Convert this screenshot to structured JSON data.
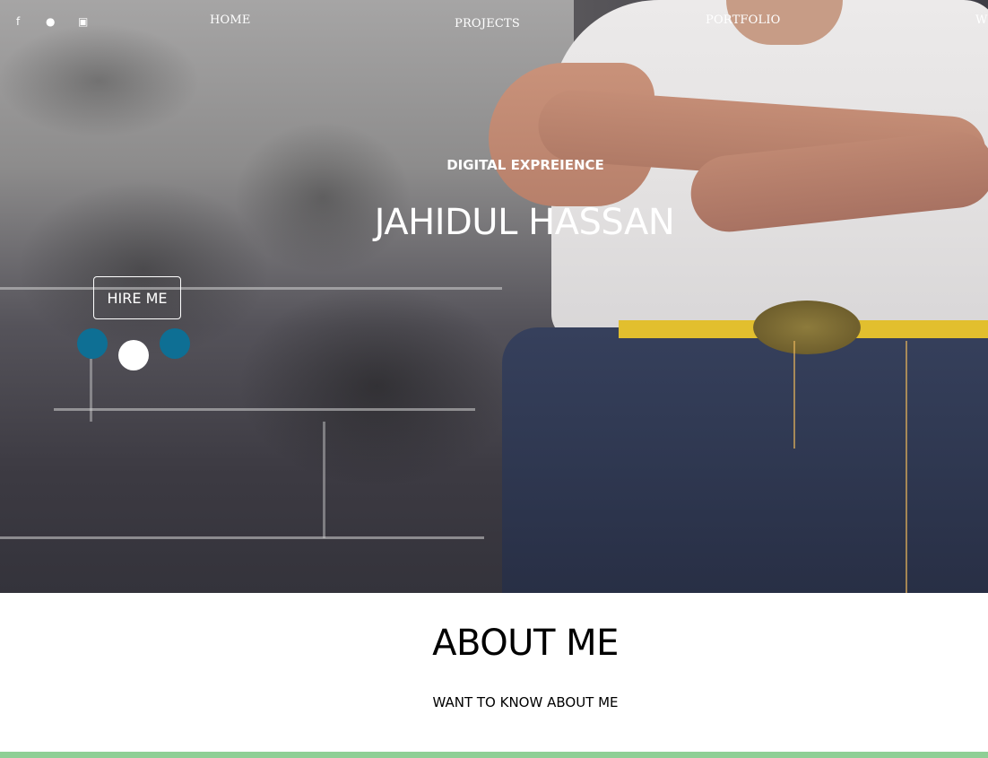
{
  "header": {
    "social": [
      {
        "icon": "facebook-icon",
        "glyph": "f"
      },
      {
        "icon": "snapchat-icon",
        "glyph": "●"
      },
      {
        "icon": "youtube-icon",
        "glyph": "▣"
      }
    ],
    "nav": [
      {
        "label": "HOME"
      },
      {
        "label": "PROJECTS"
      },
      {
        "label": "PORTFOLIO"
      },
      {
        "label": "W"
      }
    ]
  },
  "hero": {
    "subtitle": "DIGITAL EXPREIENCE",
    "title": "JAHIDUL HASSAN",
    "cta_label": "HIRE ME",
    "slider": {
      "count": 3,
      "active_index": 1,
      "active_color": "#ffffff",
      "inactive_color": "#0e6f94"
    }
  },
  "about": {
    "title": "ABOUT ME",
    "subtitle": "WANT TO KNOW ABOUT ME"
  },
  "colors": {
    "accent_bar": "#8fcf95"
  }
}
